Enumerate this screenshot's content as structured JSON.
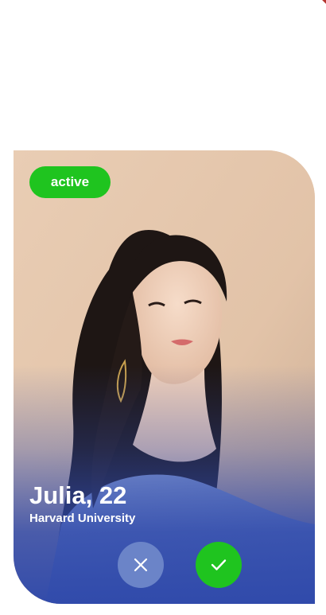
{
  "profile": {
    "status": "active",
    "name_age": "Julia, 22",
    "school": "Harvard University"
  },
  "actions": {
    "reject_icon": "close-icon",
    "accept_icon": "check-icon"
  },
  "colors": {
    "status_badge": "#1fc41f",
    "accept_button": "#1fc41f",
    "reject_button": "#6b84c8",
    "overlay": "#2f49aa",
    "photo_background": "#e8cdb5"
  }
}
